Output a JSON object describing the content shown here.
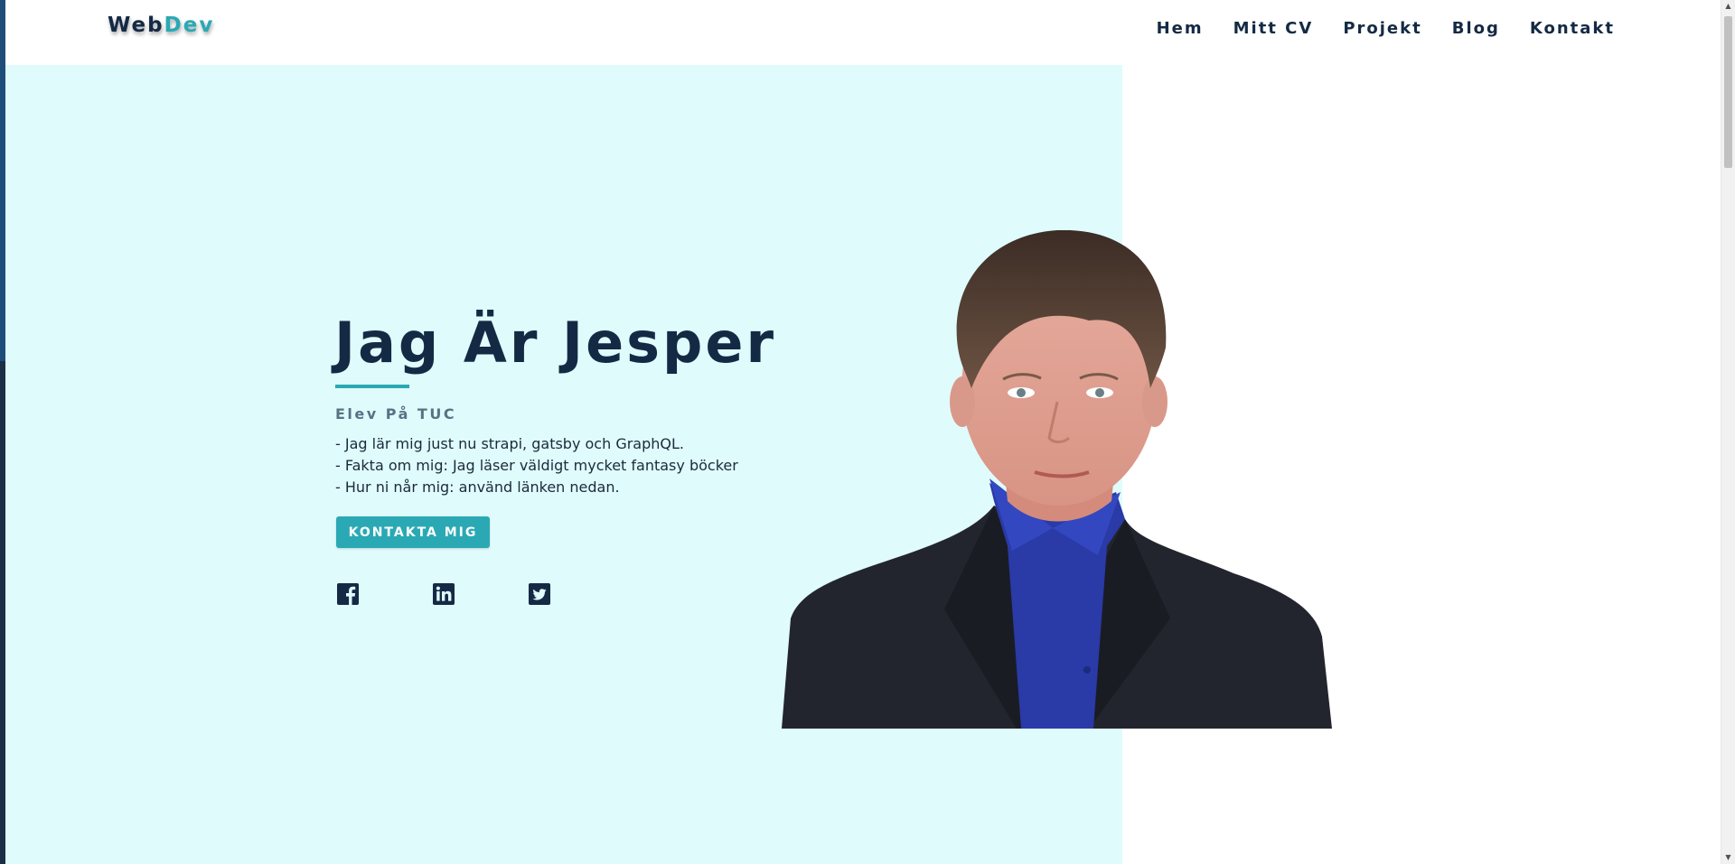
{
  "header": {
    "logo_part1": "Web",
    "logo_part2": "Dev",
    "nav": [
      "Hem",
      "Mitt CV",
      "Projekt",
      "Blog",
      "Kontakt"
    ]
  },
  "hero": {
    "title": "Jag Är Jesper",
    "subtitle": "Elev På TUC",
    "bio": [
      "- Jag lär mig just nu strapi, gatsby och GraphQL.",
      "- Fakta om mig: Jag läser väldigt mycket fantasy böcker",
      "- Hur ni når mig: använd länken nedan."
    ],
    "cta_label": "KONTAKTA MIG",
    "social_icons": [
      "facebook-icon",
      "linkedin-icon",
      "twitter-icon"
    ]
  },
  "colors": {
    "primary": "#142a44",
    "accent": "#2aa9b4",
    "hero_bg": "#e0fbfc",
    "subtitle": "#5a7184"
  }
}
